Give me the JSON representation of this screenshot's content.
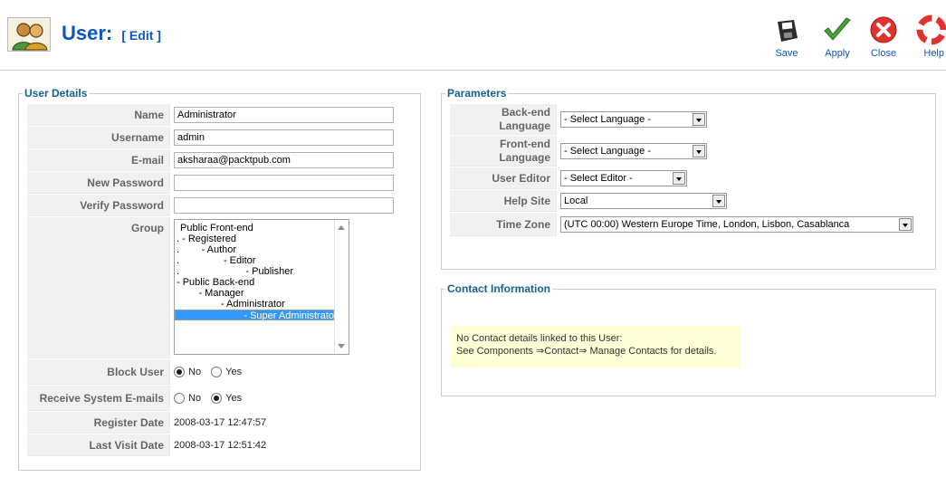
{
  "header": {
    "title": "User:",
    "subtitle": "[ Edit ]"
  },
  "toolbar": {
    "save_label": "Save",
    "apply_label": "Apply",
    "close_label": "Close",
    "help_label": "Help"
  },
  "user_details": {
    "legend": "User Details",
    "name_label": "Name",
    "name_value": "Administrator",
    "username_label": "Username",
    "username_value": "admin",
    "email_label": "E-mail",
    "email_value": "aksharaa@packtpub.com",
    "new_password_label": "New Password",
    "verify_password_label": "Verify Password",
    "group_label": "Group",
    "group_options": [
      "Public Front-end",
      ". - Registered",
      ".        - Author",
      ".                - Editor",
      ".                        - Publisher",
      "- Public Back-end",
      "        - Manager",
      "                - Administrator",
      "                        - Super Administrator"
    ],
    "block_user_label": "Block User",
    "receive_emails_label": "Receive System E-mails",
    "radio_no": "No",
    "radio_yes": "Yes",
    "register_date_label": "Register Date",
    "register_date_value": "2008-03-17 12:47:57",
    "last_visit_label": "Last Visit Date",
    "last_visit_value": "2008-03-17 12:51:42"
  },
  "parameters": {
    "legend": "Parameters",
    "backend_language_label_1": "Back-end",
    "backend_language_label_2": "Language",
    "backend_language_value": "- Select Language -",
    "frontend_language_label_1": "Front-end",
    "frontend_language_label_2": "Language",
    "frontend_language_value": "- Select Language -",
    "user_editor_label": "User Editor",
    "user_editor_value": "- Select Editor -",
    "help_site_label": "Help Site",
    "help_site_value": "Local",
    "time_zone_label": "Time Zone",
    "time_zone_value": "(UTC 00:00) Western Europe Time, London, Lisbon, Casablanca"
  },
  "contact": {
    "legend": "Contact Information",
    "line1": "No Contact details linked to this User:",
    "line2": "See Components ⇒Contact⇒ Manage Contacts for details."
  },
  "colors": {
    "title_blue": "#0b55c4",
    "legend_blue": "#146295",
    "selected_option": "#3399ff",
    "notice_bg": "#ffffd7"
  },
  "icons": [
    "users-icon",
    "save-icon",
    "apply-icon",
    "close-icon",
    "help-icon",
    "chevron-down-icon"
  ]
}
